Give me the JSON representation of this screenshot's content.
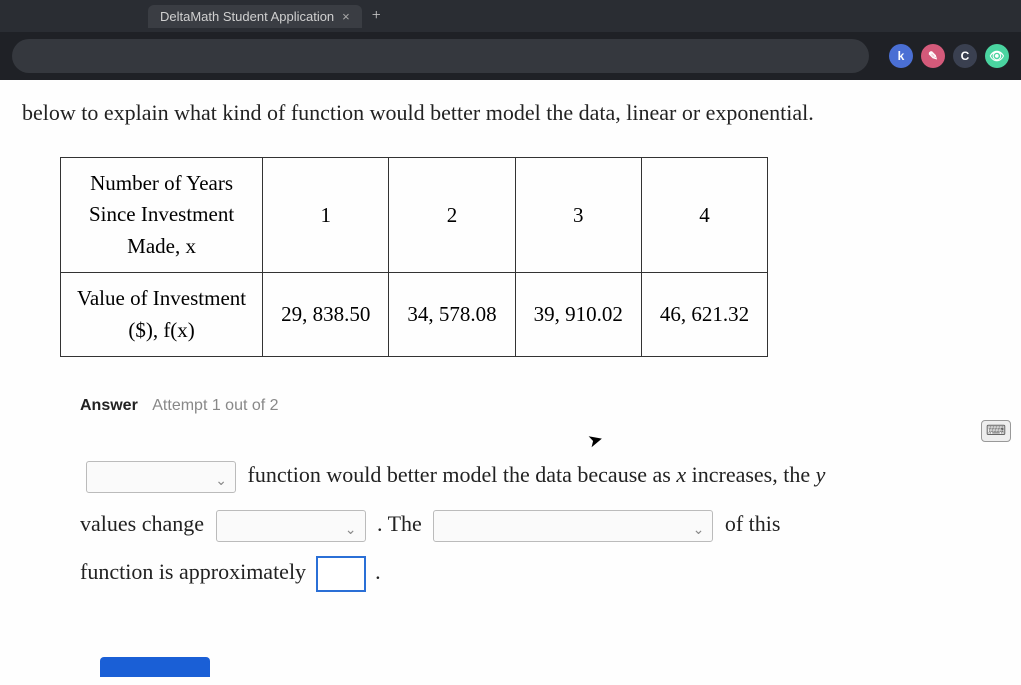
{
  "browser": {
    "tab_title": "DeltaMath Student Application",
    "ext_k": "k",
    "ext_c": "C"
  },
  "prompt": "below to explain what kind of function would better model the data, linear or exponential.",
  "table": {
    "row1_label": "Number of Years\nSince Investment\nMade, x",
    "row2_label": "Value of Investment\n($), f(x)",
    "cols": [
      "1",
      "2",
      "3",
      "4"
    ],
    "values": [
      "29, 838.50",
      "34, 578.08",
      "39, 910.02",
      "46, 621.32"
    ]
  },
  "answer": {
    "label": "Answer",
    "attempt": "Attempt 1 out of 2",
    "s1": "function would better model the data because as",
    "var_x": "x",
    "s2": "increases, the",
    "var_y": "y",
    "s3": "values change",
    "s4": ". The",
    "s5": "of this",
    "s6": "function is approximately",
    "s7": "."
  }
}
